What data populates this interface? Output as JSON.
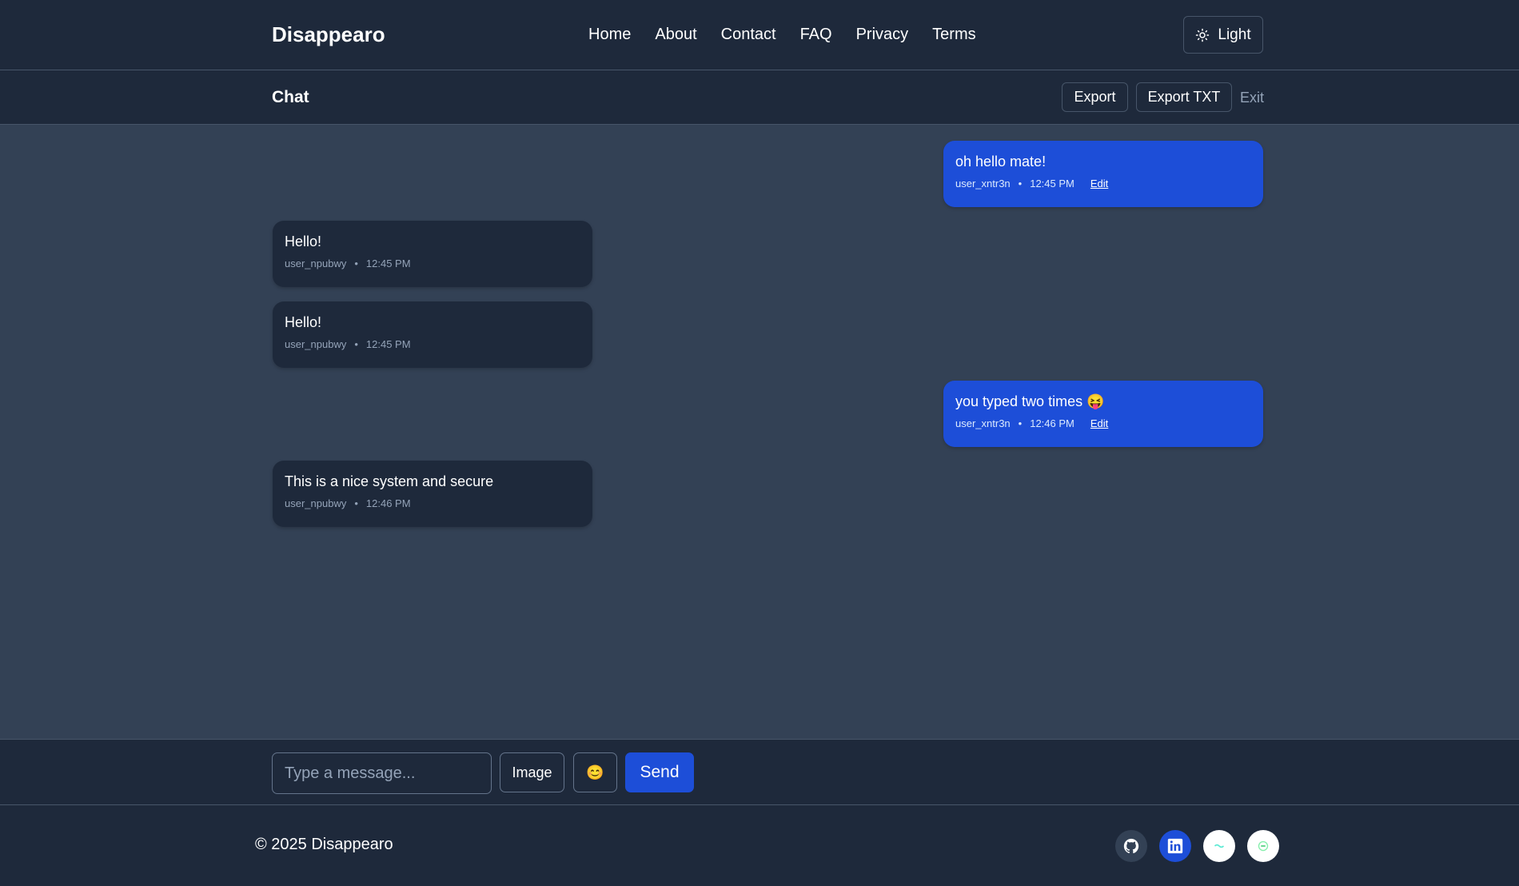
{
  "nav": {
    "brand": "Disappearo",
    "links": [
      "Home",
      "About",
      "Contact",
      "FAQ",
      "Privacy",
      "Terms"
    ],
    "theme_toggle": {
      "label": "Light",
      "icon": "sun-icon"
    }
  },
  "chat_header": {
    "title": "Chat",
    "export_label": "Export",
    "export_txt_label": "Export TXT",
    "exit_label": "Exit"
  },
  "messages": [
    {
      "direction": "out",
      "text": "oh hello mate!",
      "user": "user_xntr3n",
      "time": "12:45 PM",
      "edit_label": "Edit"
    },
    {
      "direction": "in",
      "text": "Hello!",
      "user": "user_npubwy",
      "time": "12:45 PM"
    },
    {
      "direction": "in",
      "text": "Hello!",
      "user": "user_npubwy",
      "time": "12:45 PM"
    },
    {
      "direction": "out",
      "text": "you typed two times 😝",
      "user": "user_xntr3n",
      "time": "12:46 PM",
      "edit_label": "Edit"
    },
    {
      "direction": "in",
      "text": "This is a nice system and secure",
      "user": "user_npubwy",
      "time": "12:46 PM"
    }
  ],
  "meta_separator": "•",
  "composer": {
    "placeholder": "Type a message...",
    "value": "",
    "image_label": "Image",
    "emoji_label": "😊",
    "send_label": "Send"
  },
  "footer": {
    "copyright": "© 2025 Disappearo",
    "social_icons": [
      "github-icon",
      "linkedin-icon",
      "social-icon-3",
      "social-icon-4"
    ]
  },
  "colors": {
    "page_bg": "#334155",
    "bar_bg": "#1e293b",
    "accent": "#1d4ed8",
    "border": "#475569",
    "muted_text": "#94a3b8"
  }
}
